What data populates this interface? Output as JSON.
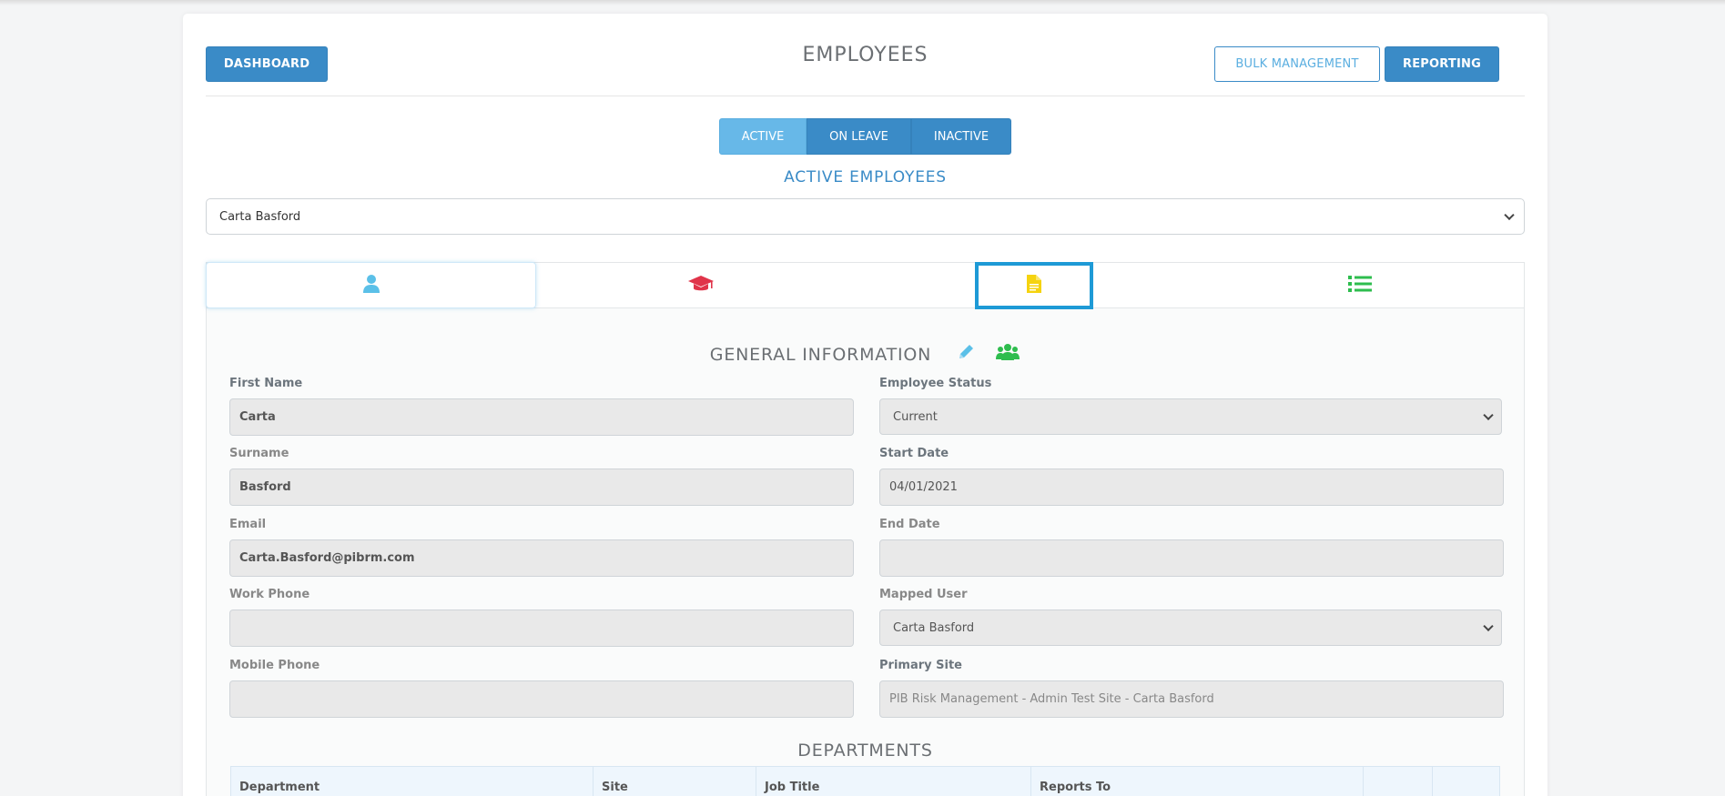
{
  "header": {
    "title": "EMPLOYEES",
    "dashboard_label": "DASHBOARD",
    "bulk_management_label": "BULK MANAGEMENT",
    "reporting_label": "REPORTING"
  },
  "status_tabs": [
    {
      "label": "ACTIVE",
      "active": true
    },
    {
      "label": "ON LEAVE",
      "active": false
    },
    {
      "label": "INACTIVE",
      "active": false
    }
  ],
  "list_heading": "ACTIVE EMPLOYEES",
  "employee_select": {
    "value": "Carta Basford"
  },
  "profile_tabs": [
    {
      "icon": "user-icon",
      "color": "#5bc0e8",
      "active": true
    },
    {
      "icon": "graduation-cap-icon",
      "color": "#e0344a",
      "active": false
    },
    {
      "icon": "document-icon",
      "color": "#f5d30f",
      "focused": true
    },
    {
      "icon": "list-icon",
      "color": "#2ebd4e",
      "active": false
    }
  ],
  "general": {
    "title": "GENERAL INFORMATION",
    "edit_icon_color": "#5bc0e8",
    "team_icon_color": "#2ebd4e"
  },
  "fields": {
    "first_name": {
      "label": "First Name",
      "value": "Carta"
    },
    "surname": {
      "label": "Surname",
      "value": "Basford"
    },
    "email": {
      "label": "Email",
      "value": "Carta.Basford@pibrm.com"
    },
    "work_phone": {
      "label": "Work Phone",
      "value": ""
    },
    "mobile_phone": {
      "label": "Mobile Phone",
      "value": ""
    },
    "employee_status": {
      "label": "Employee Status",
      "value": "Current"
    },
    "start_date": {
      "label": "Start Date",
      "value": "04/01/2021"
    },
    "end_date": {
      "label": "End Date",
      "value": ""
    },
    "mapped_user": {
      "label": "Mapped User",
      "value": "Carta Basford"
    },
    "primary_site": {
      "label": "Primary Site",
      "value": "PIB Risk Management - Admin Test Site - Carta Basford"
    }
  },
  "departments": {
    "title": "DEPARTMENTS",
    "columns": [
      "Department",
      "Site",
      "Job Title",
      "Reports To",
      "",
      ""
    ]
  },
  "colors": {
    "primary": "#3a8bc7",
    "active_tab": "#67b8e8",
    "focus_outline": "#1e9ad6"
  }
}
